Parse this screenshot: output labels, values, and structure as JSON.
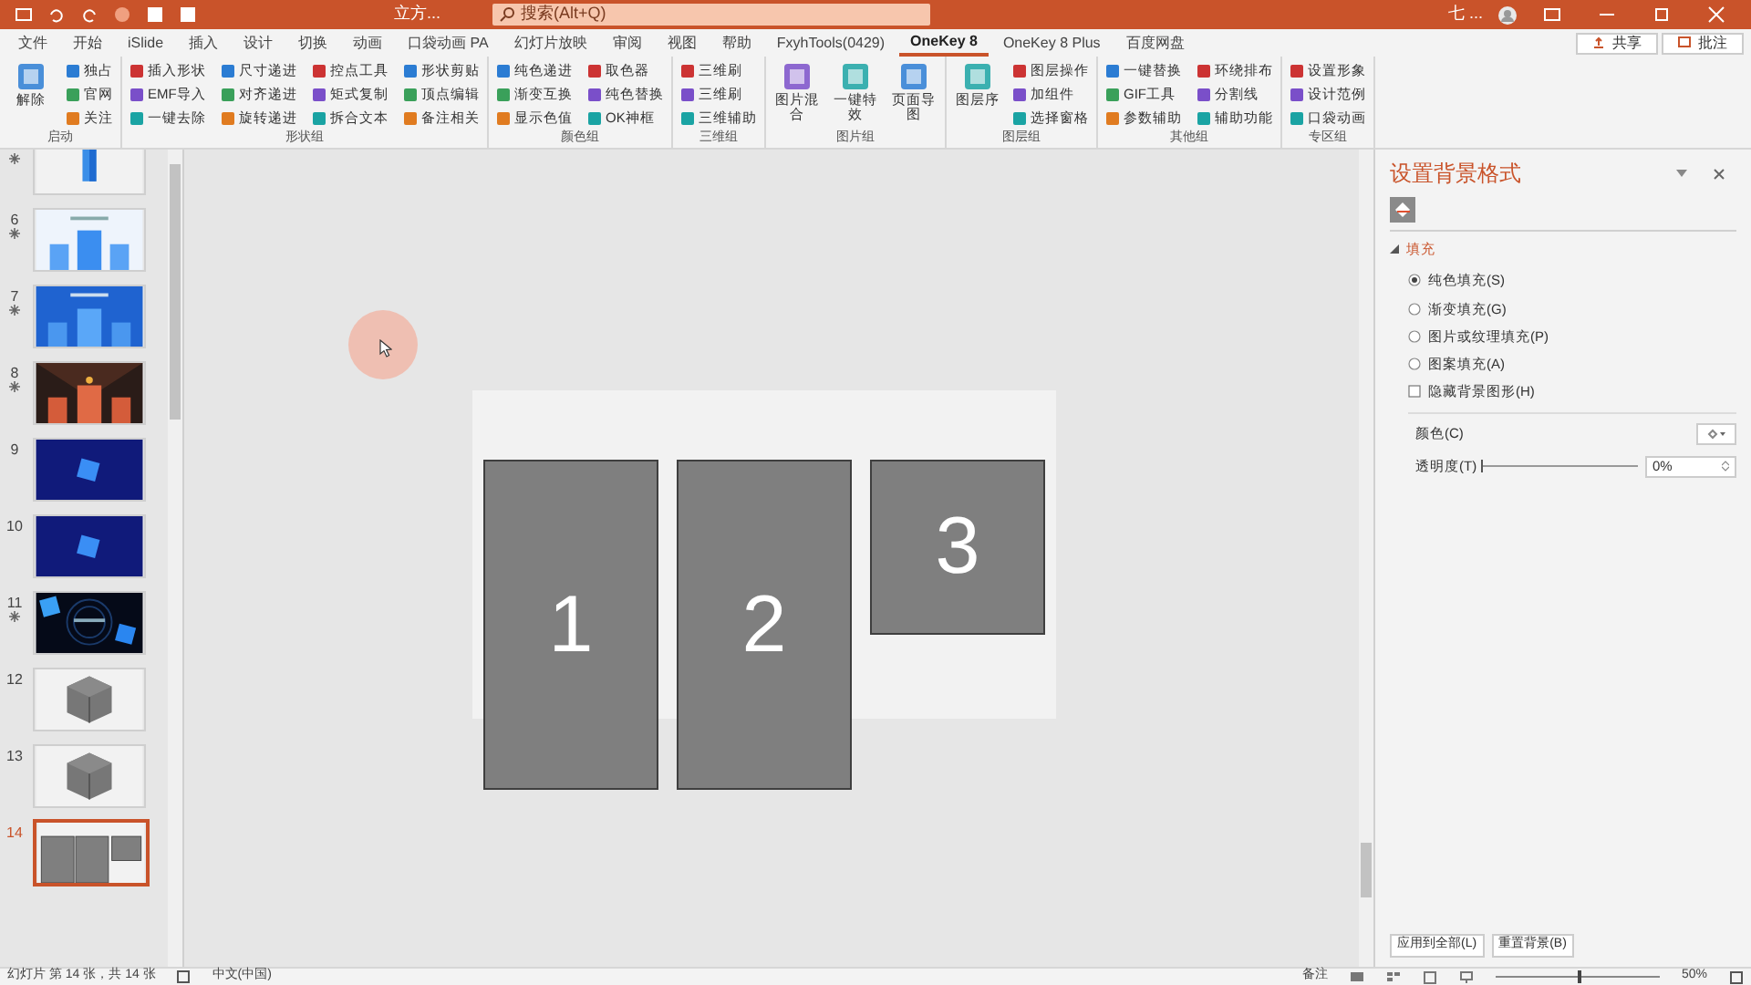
{
  "title_bar": {
    "title": "立方...",
    "search_placeholder": "搜索(Alt+Q)",
    "user": "七 ..."
  },
  "tabs": [
    {
      "label": "文件",
      "selected": false
    },
    {
      "label": "开始",
      "selected": false
    },
    {
      "label": "iSlide",
      "selected": false
    },
    {
      "label": "插入",
      "selected": false
    },
    {
      "label": "设计",
      "selected": false
    },
    {
      "label": "切换",
      "selected": false
    },
    {
      "label": "动画",
      "selected": false
    },
    {
      "label": "口袋动画 PA",
      "selected": false
    },
    {
      "label": "幻灯片放映",
      "selected": false
    },
    {
      "label": "审阅",
      "selected": false
    },
    {
      "label": "视图",
      "selected": false
    },
    {
      "label": "帮助",
      "selected": false
    },
    {
      "label": "FxyhTools(0429)",
      "selected": false
    },
    {
      "label": "OneKey 8",
      "selected": true
    },
    {
      "label": "OneKey 8 Plus",
      "selected": false
    },
    {
      "label": "百度网盘",
      "selected": false
    }
  ],
  "share_button": "共享",
  "comment_button": "批注",
  "ribbon_groups": [
    {
      "label": "启动",
      "large": [
        "解除"
      ],
      "small": [
        "独占",
        "官网",
        "关注"
      ]
    },
    {
      "label": "形状组",
      "small": [
        "插入形状",
        "EMF导入",
        "一键去除",
        "尺寸递进",
        "对齐递进",
        "旋转递进",
        "控点工具",
        "矩式复制",
        "拆合文本",
        "形状剪贴",
        "顶点编辑",
        "备注相关"
      ]
    },
    {
      "label": "颜色组",
      "small": [
        "纯色递进",
        "渐变互换",
        "显示色值",
        "取色器",
        "纯色替换",
        "OK神框"
      ]
    },
    {
      "label": "三维组",
      "small": [
        "三维刷",
        "三维刷",
        "三维辅助"
      ]
    },
    {
      "label": "图片组",
      "large": [
        "图片混合",
        "一键特效",
        "页面导图"
      ]
    },
    {
      "label": "图层组",
      "large": [
        "图层序"
      ],
      "small": [
        "图层操作",
        "加组件",
        "选择窗格"
      ]
    },
    {
      "label": "其他组",
      "small": [
        "一键替换",
        "GIF工具",
        "参数辅助",
        "环绕排布",
        "分割线",
        "辅助功能"
      ]
    },
    {
      "label": "专区组",
      "small": [
        "设置形象",
        "设计范例",
        "口袋动画"
      ]
    }
  ],
  "slides": [
    {
      "animated": true,
      "kind": "picture",
      "selected": false
    },
    {
      "number": "6",
      "animated": true,
      "kind": "picture",
      "selected": false
    },
    {
      "number": "7",
      "animated": true,
      "kind": "picture",
      "selected": false
    },
    {
      "number": "8",
      "animated": true,
      "kind": "picture",
      "selected": false
    },
    {
      "number": "9",
      "animated": false,
      "kind": "picture",
      "selected": false
    },
    {
      "number": "10",
      "animated": false,
      "kind": "picture",
      "selected": false
    },
    {
      "number": "11",
      "animated": true,
      "kind": "picture",
      "selected": false
    },
    {
      "number": "12",
      "animated": false,
      "kind": "picture",
      "selected": false
    },
    {
      "number": "13",
      "animated": false,
      "kind": "picture",
      "selected": false
    },
    {
      "number": "14",
      "animated": false,
      "kind": "picture",
      "selected": true
    }
  ],
  "slide_shapes": [
    {
      "label": "1",
      "kind": "tall"
    },
    {
      "label": "2",
      "kind": "tall"
    },
    {
      "label": "3",
      "kind": "short"
    }
  ],
  "format_pane": {
    "title": "设置背景格式",
    "section": "填充",
    "expanded": true,
    "fill_options": [
      {
        "label": "纯色填充(S)",
        "selected": true
      },
      {
        "label": "渐变填充(G)",
        "selected": false
      },
      {
        "label": "图片或纹理填充(P)",
        "selected": false
      },
      {
        "label": "图案填充(A)",
        "selected": false
      }
    ],
    "hide_graphics": {
      "label": "隐藏背景图形(H)",
      "checked": false
    },
    "color_label": "颜色(C)",
    "transparency_label": "透明度(T)",
    "transparency": {
      "level": 0,
      "value": "0%"
    },
    "buttons": [
      "应用到全部(L)",
      "重置背景(B)"
    ]
  },
  "status_bar": {
    "slide_info": "幻灯片 第 14 张，共 14 张",
    "language": "中文(中国)",
    "notes": "备注",
    "zoom": "50%",
    "zoom_slider": {
      "level": 0.5
    }
  }
}
